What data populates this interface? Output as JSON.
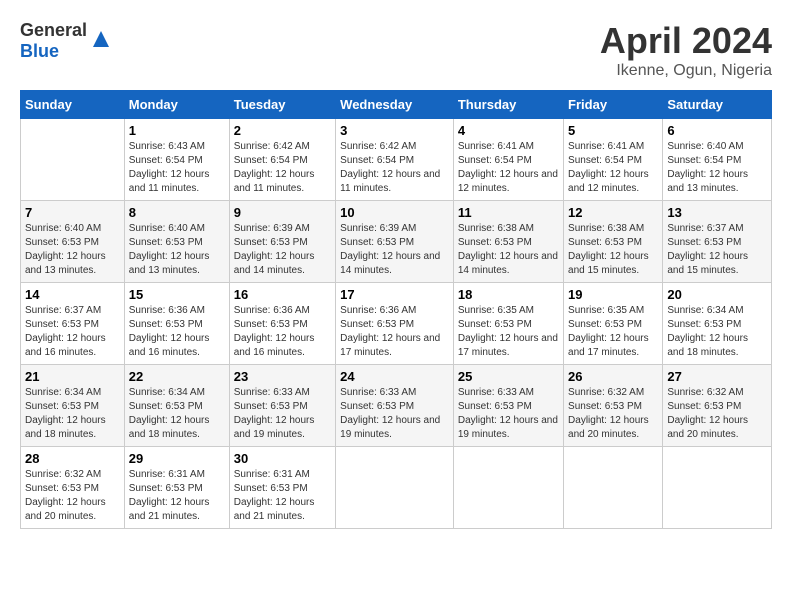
{
  "header": {
    "logo_general": "General",
    "logo_blue": "Blue",
    "title": "April 2024",
    "subtitle": "Ikenne, Ogun, Nigeria"
  },
  "days_of_week": [
    "Sunday",
    "Monday",
    "Tuesday",
    "Wednesday",
    "Thursday",
    "Friday",
    "Saturday"
  ],
  "weeks": [
    [
      {
        "day": "",
        "sunrise": "",
        "sunset": "",
        "daylight": ""
      },
      {
        "day": "1",
        "sunrise": "Sunrise: 6:43 AM",
        "sunset": "Sunset: 6:54 PM",
        "daylight": "Daylight: 12 hours and 11 minutes."
      },
      {
        "day": "2",
        "sunrise": "Sunrise: 6:42 AM",
        "sunset": "Sunset: 6:54 PM",
        "daylight": "Daylight: 12 hours and 11 minutes."
      },
      {
        "day": "3",
        "sunrise": "Sunrise: 6:42 AM",
        "sunset": "Sunset: 6:54 PM",
        "daylight": "Daylight: 12 hours and 11 minutes."
      },
      {
        "day": "4",
        "sunrise": "Sunrise: 6:41 AM",
        "sunset": "Sunset: 6:54 PM",
        "daylight": "Daylight: 12 hours and 12 minutes."
      },
      {
        "day": "5",
        "sunrise": "Sunrise: 6:41 AM",
        "sunset": "Sunset: 6:54 PM",
        "daylight": "Daylight: 12 hours and 12 minutes."
      },
      {
        "day": "6",
        "sunrise": "Sunrise: 6:40 AM",
        "sunset": "Sunset: 6:54 PM",
        "daylight": "Daylight: 12 hours and 13 minutes."
      }
    ],
    [
      {
        "day": "7",
        "sunrise": "Sunrise: 6:40 AM",
        "sunset": "Sunset: 6:53 PM",
        "daylight": "Daylight: 12 hours and 13 minutes."
      },
      {
        "day": "8",
        "sunrise": "Sunrise: 6:40 AM",
        "sunset": "Sunset: 6:53 PM",
        "daylight": "Daylight: 12 hours and 13 minutes."
      },
      {
        "day": "9",
        "sunrise": "Sunrise: 6:39 AM",
        "sunset": "Sunset: 6:53 PM",
        "daylight": "Daylight: 12 hours and 14 minutes."
      },
      {
        "day": "10",
        "sunrise": "Sunrise: 6:39 AM",
        "sunset": "Sunset: 6:53 PM",
        "daylight": "Daylight: 12 hours and 14 minutes."
      },
      {
        "day": "11",
        "sunrise": "Sunrise: 6:38 AM",
        "sunset": "Sunset: 6:53 PM",
        "daylight": "Daylight: 12 hours and 14 minutes."
      },
      {
        "day": "12",
        "sunrise": "Sunrise: 6:38 AM",
        "sunset": "Sunset: 6:53 PM",
        "daylight": "Daylight: 12 hours and 15 minutes."
      },
      {
        "day": "13",
        "sunrise": "Sunrise: 6:37 AM",
        "sunset": "Sunset: 6:53 PM",
        "daylight": "Daylight: 12 hours and 15 minutes."
      }
    ],
    [
      {
        "day": "14",
        "sunrise": "Sunrise: 6:37 AM",
        "sunset": "Sunset: 6:53 PM",
        "daylight": "Daylight: 12 hours and 16 minutes."
      },
      {
        "day": "15",
        "sunrise": "Sunrise: 6:36 AM",
        "sunset": "Sunset: 6:53 PM",
        "daylight": "Daylight: 12 hours and 16 minutes."
      },
      {
        "day": "16",
        "sunrise": "Sunrise: 6:36 AM",
        "sunset": "Sunset: 6:53 PM",
        "daylight": "Daylight: 12 hours and 16 minutes."
      },
      {
        "day": "17",
        "sunrise": "Sunrise: 6:36 AM",
        "sunset": "Sunset: 6:53 PM",
        "daylight": "Daylight: 12 hours and 17 minutes."
      },
      {
        "day": "18",
        "sunrise": "Sunrise: 6:35 AM",
        "sunset": "Sunset: 6:53 PM",
        "daylight": "Daylight: 12 hours and 17 minutes."
      },
      {
        "day": "19",
        "sunrise": "Sunrise: 6:35 AM",
        "sunset": "Sunset: 6:53 PM",
        "daylight": "Daylight: 12 hours and 17 minutes."
      },
      {
        "day": "20",
        "sunrise": "Sunrise: 6:34 AM",
        "sunset": "Sunset: 6:53 PM",
        "daylight": "Daylight: 12 hours and 18 minutes."
      }
    ],
    [
      {
        "day": "21",
        "sunrise": "Sunrise: 6:34 AM",
        "sunset": "Sunset: 6:53 PM",
        "daylight": "Daylight: 12 hours and 18 minutes."
      },
      {
        "day": "22",
        "sunrise": "Sunrise: 6:34 AM",
        "sunset": "Sunset: 6:53 PM",
        "daylight": "Daylight: 12 hours and 18 minutes."
      },
      {
        "day": "23",
        "sunrise": "Sunrise: 6:33 AM",
        "sunset": "Sunset: 6:53 PM",
        "daylight": "Daylight: 12 hours and 19 minutes."
      },
      {
        "day": "24",
        "sunrise": "Sunrise: 6:33 AM",
        "sunset": "Sunset: 6:53 PM",
        "daylight": "Daylight: 12 hours and 19 minutes."
      },
      {
        "day": "25",
        "sunrise": "Sunrise: 6:33 AM",
        "sunset": "Sunset: 6:53 PM",
        "daylight": "Daylight: 12 hours and 19 minutes."
      },
      {
        "day": "26",
        "sunrise": "Sunrise: 6:32 AM",
        "sunset": "Sunset: 6:53 PM",
        "daylight": "Daylight: 12 hours and 20 minutes."
      },
      {
        "day": "27",
        "sunrise": "Sunrise: 6:32 AM",
        "sunset": "Sunset: 6:53 PM",
        "daylight": "Daylight: 12 hours and 20 minutes."
      }
    ],
    [
      {
        "day": "28",
        "sunrise": "Sunrise: 6:32 AM",
        "sunset": "Sunset: 6:53 PM",
        "daylight": "Daylight: 12 hours and 20 minutes."
      },
      {
        "day": "29",
        "sunrise": "Sunrise: 6:31 AM",
        "sunset": "Sunset: 6:53 PM",
        "daylight": "Daylight: 12 hours and 21 minutes."
      },
      {
        "day": "30",
        "sunrise": "Sunrise: 6:31 AM",
        "sunset": "Sunset: 6:53 PM",
        "daylight": "Daylight: 12 hours and 21 minutes."
      },
      {
        "day": "",
        "sunrise": "",
        "sunset": "",
        "daylight": ""
      },
      {
        "day": "",
        "sunrise": "",
        "sunset": "",
        "daylight": ""
      },
      {
        "day": "",
        "sunrise": "",
        "sunset": "",
        "daylight": ""
      },
      {
        "day": "",
        "sunrise": "",
        "sunset": "",
        "daylight": ""
      }
    ]
  ]
}
